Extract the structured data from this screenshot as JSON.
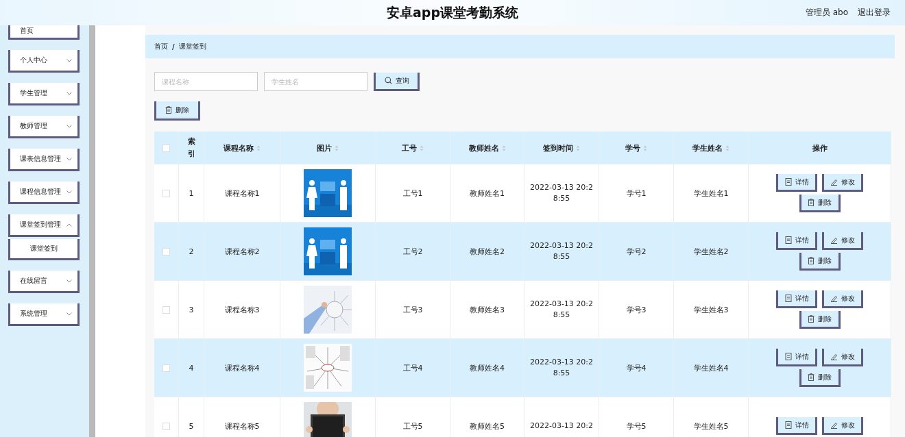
{
  "header": {
    "title": "安卓app课堂考勤系统",
    "user": "管理员 abo",
    "logout": "退出登录"
  },
  "sidebar": {
    "items": [
      {
        "label": "首页",
        "expandable": false
      },
      {
        "label": "个人中心",
        "expandable": true,
        "expanded": false
      },
      {
        "label": "学生管理",
        "expandable": true,
        "expanded": false
      },
      {
        "label": "教师管理",
        "expandable": true,
        "expanded": false
      },
      {
        "label": "课表信息管理",
        "expandable": true,
        "expanded": false
      },
      {
        "label": "课程信息管理",
        "expandable": true,
        "expanded": false
      },
      {
        "label": "课堂签到管理",
        "expandable": true,
        "expanded": true,
        "children": [
          {
            "label": "课堂签到"
          }
        ]
      },
      {
        "label": "在线留言",
        "expandable": true,
        "expanded": false
      },
      {
        "label": "系统管理",
        "expandable": true,
        "expanded": false
      }
    ]
  },
  "breadcrumb": {
    "items": [
      "首页",
      "课堂签到"
    ],
    "separator": "/"
  },
  "search": {
    "fields": [
      {
        "placeholder": "课程名称"
      },
      {
        "placeholder": "学生姓名"
      }
    ],
    "button": "查询"
  },
  "toolbar": {
    "delete": "删除"
  },
  "table": {
    "select_all": {
      "checked": false
    },
    "columns": [
      {
        "label": "索引",
        "sortable": false
      },
      {
        "label": "课程名称",
        "sortable": true
      },
      {
        "label": "图片",
        "sortable": true
      },
      {
        "label": "工号",
        "sortable": true
      },
      {
        "label": "教师姓名",
        "sortable": true
      },
      {
        "label": "签到时间",
        "sortable": true
      },
      {
        "label": "学号",
        "sortable": true
      },
      {
        "label": "学生姓名",
        "sortable": true
      },
      {
        "label": "操作",
        "sortable": false
      }
    ],
    "rows": [
      {
        "checked": false,
        "cells": [
          "1",
          "课程名称1",
          {
            "kind": "picture"
          },
          "工号1",
          "教师姓名1",
          "2022-03-13 20:28:55",
          "学号1",
          "学生姓名1"
        ],
        "actions": [
          "详情",
          "修改",
          "删除"
        ]
      },
      {
        "checked": false,
        "cells": [
          "2",
          "课程名称2",
          {
            "kind": "picture"
          },
          "工号2",
          "教师姓名2",
          "2022-03-13 20:28:55",
          "学号2",
          "学生姓名2"
        ],
        "actions": [
          "详情",
          "修改",
          "删除"
        ]
      },
      {
        "checked": false,
        "cells": [
          "3",
          "课程名称3",
          {
            "kind": "picture"
          },
          "工号3",
          "教师姓名3",
          "2022-03-13 20:28:55",
          "学号3",
          "学生姓名3"
        ],
        "actions": [
          "详情",
          "修改",
          "删除"
        ]
      },
      {
        "checked": false,
        "cells": [
          "4",
          "课程名称4",
          {
            "kind": "picture"
          },
          "工号4",
          "教师姓名4",
          "2022-03-13 20:28:55",
          "学号4",
          "学生姓名4"
        ],
        "actions": [
          "详情",
          "修改",
          "删除"
        ]
      },
      {
        "checked": false,
        "cells": [
          "5",
          "课程名称5",
          {
            "kind": "picture"
          },
          "工号5",
          "教师姓名5",
          "2022-03-13 20:2",
          "学号5",
          "学生姓名5"
        ],
        "actions": [
          "详情",
          "修改"
        ]
      }
    ]
  }
}
